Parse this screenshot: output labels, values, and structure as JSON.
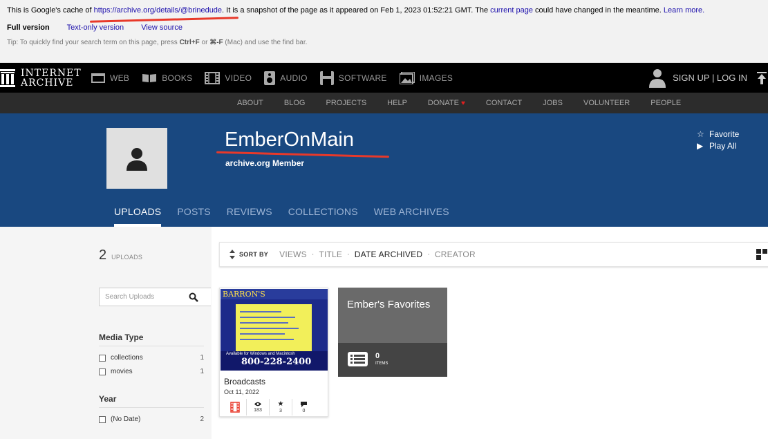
{
  "cache": {
    "prefix": "This is Google's cache of ",
    "url": "https://archive.org/details/@brinedude",
    "middle": ". It is a snapshot of the page as it appeared on Feb 1, 2023 01:52:21 GMT. The ",
    "current_page": "current page",
    "suffix": " could have changed in the meantime. ",
    "learn_more": "Learn more.",
    "full_version": "Full version",
    "text_only": "Text-only version",
    "view_source": "View source",
    "tip_prefix": "Tip: To quickly find your search term on this page, press ",
    "tip_key1": "Ctrl+F",
    "tip_or": " or ",
    "tip_key2": "⌘-F",
    "tip_suffix": " (Mac) and use the find bar.",
    "annotation_color": "#e8392a"
  },
  "topnav": {
    "logo_line1": "INTERNET",
    "logo_line2": "ARCHIVE",
    "items": [
      {
        "label": "WEB",
        "icon": "web-icon"
      },
      {
        "label": "BOOKS",
        "icon": "books-icon"
      },
      {
        "label": "VIDEO",
        "icon": "video-icon"
      },
      {
        "label": "AUDIO",
        "icon": "audio-icon"
      },
      {
        "label": "SOFTWARE",
        "icon": "software-icon"
      },
      {
        "label": "IMAGES",
        "icon": "images-icon"
      }
    ],
    "signup": "SIGN UP | LOG IN"
  },
  "subnav": {
    "items": [
      "ABOUT",
      "BLOG",
      "PROJECTS",
      "HELP",
      "DONATE",
      "CONTACT",
      "JOBS",
      "VOLUNTEER",
      "PEOPLE"
    ]
  },
  "profile": {
    "name": "EmberOnMain",
    "subtitle": "archive.org Member",
    "favorite": "Favorite",
    "play_all": "Play All",
    "band_color": "#194880",
    "tabs": [
      "UPLOADS",
      "POSTS",
      "REVIEWS",
      "COLLECTIONS",
      "WEB ARCHIVES"
    ],
    "active_tab": "UPLOADS"
  },
  "sidebar": {
    "count": "2",
    "count_label": "UPLOADS",
    "search_placeholder": "Search Uploads",
    "facets": [
      {
        "title": "Media Type",
        "rows": [
          {
            "label": "collections",
            "count": "1"
          },
          {
            "label": "movies",
            "count": "1"
          }
        ]
      },
      {
        "title": "Year",
        "rows": [
          {
            "label": "(No Date)",
            "count": "2"
          }
        ]
      }
    ]
  },
  "sortbar": {
    "label": "SORT BY",
    "options": [
      "VIEWS",
      "TITLE",
      "DATE ARCHIVED",
      "CREATOR"
    ],
    "active": "DATE ARCHIVED"
  },
  "items": {
    "broadcast": {
      "thumb_brand": "BARRON'S",
      "thumb_sub": "Available for Windows and Macintosh",
      "thumb_phone": "800-228-2400",
      "title": "Broadcasts",
      "date": "Oct 11, 2022",
      "views": "183",
      "favorites": "3",
      "reviews": "0"
    },
    "collection": {
      "title": "Ember's Favorites",
      "count": "0",
      "count_label": "ITEMS"
    }
  }
}
